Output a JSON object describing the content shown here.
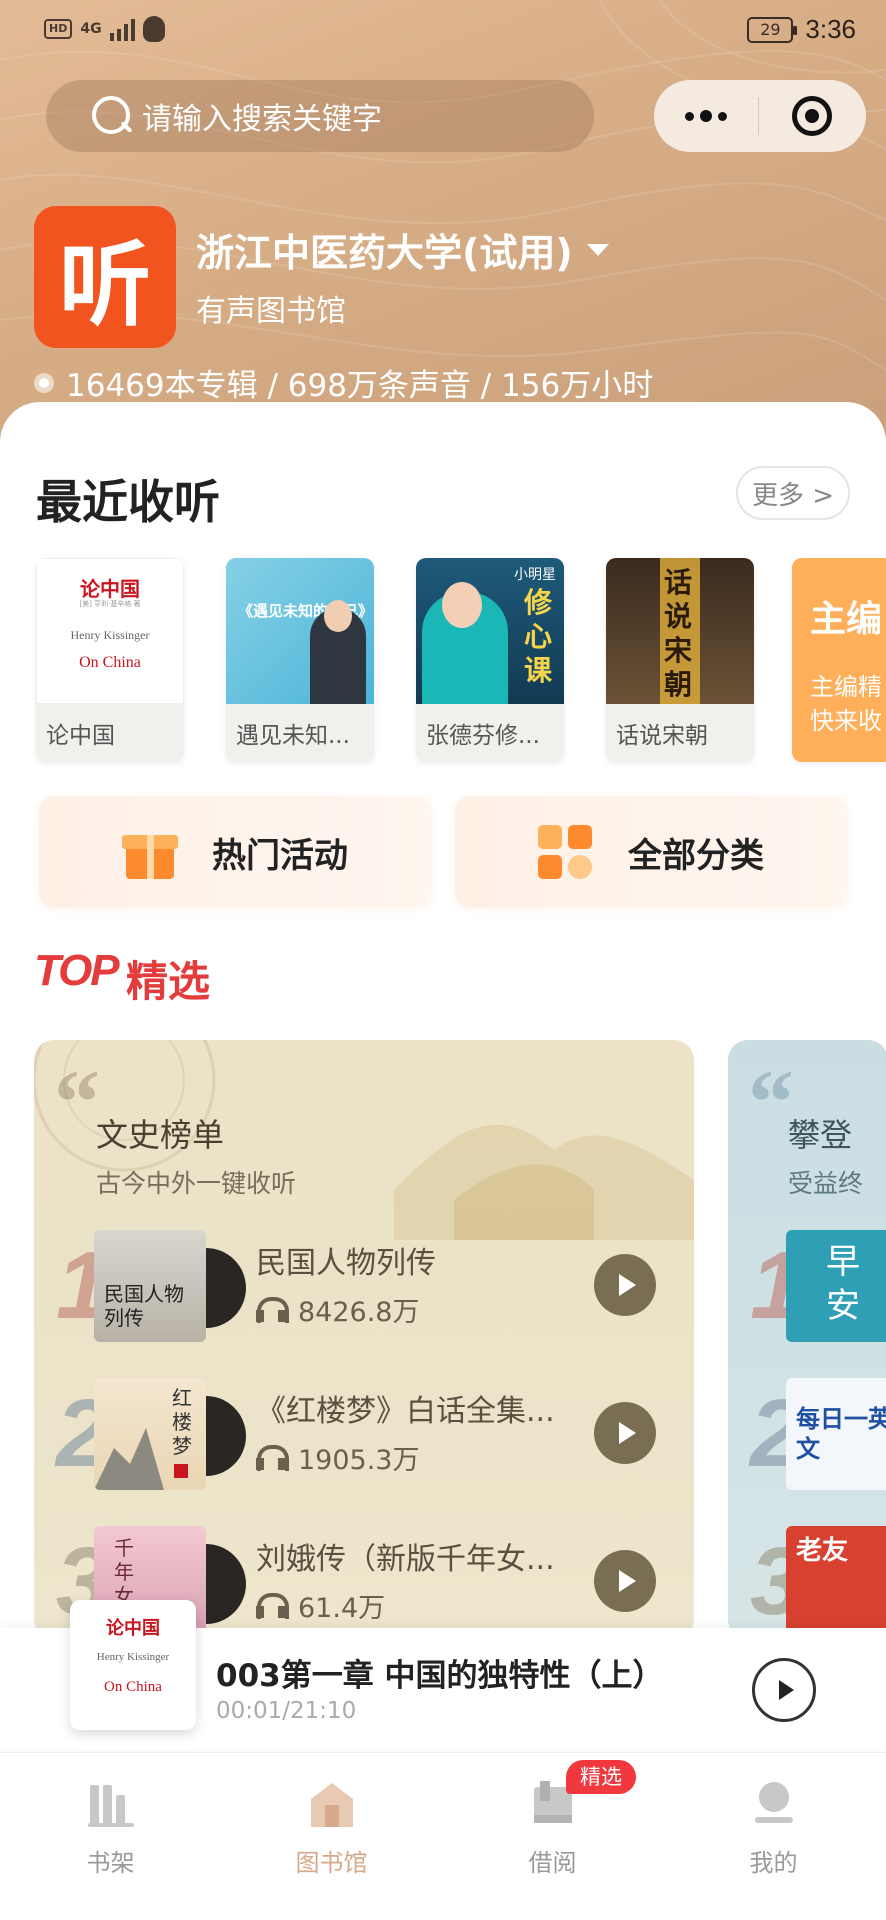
{
  "status_bar": {
    "network": "4G",
    "hd": "HD",
    "battery": "29",
    "time": "3:36"
  },
  "search": {
    "placeholder": "请输入搜索关键字"
  },
  "library": {
    "logo_char": "听",
    "name": "浙江中医药大学(试用)",
    "subtitle": "有声图书馆",
    "stats": "16469本专辑 / 698万条声音 / 156万小时"
  },
  "recent": {
    "title": "最近收听",
    "more_label": "更多 >",
    "items": [
      {
        "label": "论中国",
        "cover_title": "论中国",
        "cover_author": "[美] 亨利·基辛格 著",
        "cover_en1": "Henry Kissinger",
        "cover_en2": "On China"
      },
      {
        "label": "遇见未知...",
        "cover_title": "《遇见未知的自己》"
      },
      {
        "label": "张德芬修...",
        "cover_brand": "小明星",
        "cover_title": "修心课"
      },
      {
        "label": "话说宋朝",
        "cover_title": "话说宋朝"
      }
    ],
    "promo": {
      "title": "主编",
      "line1": "主编精",
      "line2": "快来收"
    }
  },
  "quick_actions": [
    {
      "label": "热门活动",
      "icon": "gift-icon"
    },
    {
      "label": "全部分类",
      "icon": "category-grid-icon"
    }
  ],
  "top": {
    "logo": "TOP",
    "title": "精选"
  },
  "panels": [
    {
      "title": "文史榜单",
      "subtitle": "古今中外一键收听",
      "items": [
        {
          "rank": "1",
          "title": "民国人物列传",
          "plays": "8426.8万",
          "cover_text": "民国人物列传"
        },
        {
          "rank": "2",
          "title": "《红楼梦》白话全集...",
          "plays": "1905.3万",
          "cover_text": "红楼梦"
        },
        {
          "rank": "3",
          "title": "刘娥传（新版千年女...",
          "plays": "61.4万",
          "cover_text": "千年女"
        }
      ]
    },
    {
      "title": "攀登",
      "subtitle": "受益终",
      "items": [
        {
          "rank": "1",
          "cover_text": "早安"
        },
        {
          "rank": "2",
          "cover_text": "每日一英文"
        },
        {
          "rank": "3",
          "cover_text": "老友"
        }
      ]
    }
  ],
  "player": {
    "title": "003第一章 中国的独特性（上）",
    "time": "00:01/21:10",
    "cover_title": "论中国",
    "cover_en1": "Henry Kissinger",
    "cover_en2": "On China"
  },
  "tabs": [
    {
      "label": "书架",
      "icon": "bookshelf-icon",
      "active": false
    },
    {
      "label": "图书馆",
      "icon": "library-house-icon",
      "active": true
    },
    {
      "label": "借阅",
      "icon": "borrow-icon",
      "active": false
    },
    {
      "label": "我的",
      "icon": "profile-icon",
      "active": false
    }
  ],
  "badge": {
    "label": "精选"
  },
  "colors": {
    "brand": "#f2541f",
    "accent_top": "#e43c3c",
    "tab_active": "#d7a98a",
    "badge": "#f0383e"
  }
}
